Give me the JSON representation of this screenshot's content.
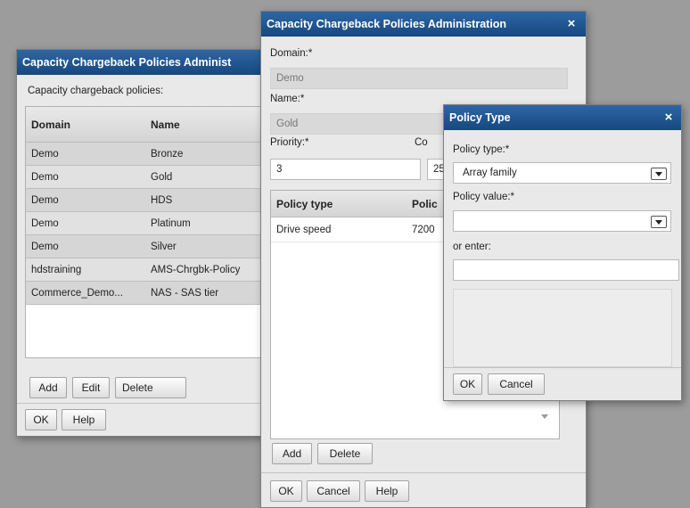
{
  "back": {
    "title": "Capacity Chargeback Policies Administ",
    "list_label": "Capacity chargeback policies:",
    "columns": [
      "Domain",
      "Name"
    ],
    "rows": [
      {
        "domain": "Demo",
        "name": "Bronze"
      },
      {
        "domain": "Demo",
        "name": "Gold"
      },
      {
        "domain": "Demo",
        "name": "HDS"
      },
      {
        "domain": "Demo",
        "name": "Platinum"
      },
      {
        "domain": "Demo",
        "name": "Silver"
      },
      {
        "domain": "hdstraining",
        "name": "AMS-Chrgbk-Policy"
      },
      {
        "domain": "Commerce_Demo...",
        "name": "NAS - SAS tier"
      }
    ],
    "add_label": "Add",
    "edit_label": "Edit",
    "delete_label": "Delete",
    "ok_label": "OK",
    "help_label": "Help"
  },
  "mid": {
    "title": "Capacity Chargeback Policies Administration",
    "close": "×",
    "domain_label": "Domain:*",
    "domain_value": "Demo",
    "name_label": "Name:*",
    "name_value": "Gold",
    "priority_label": "Priority:*",
    "priority_value": "3",
    "co_label": "Co",
    "co_value": "25",
    "columns": [
      "Policy type",
      "Polic"
    ],
    "rows": [
      {
        "type": "Drive speed",
        "value": "7200"
      }
    ],
    "add_label": "Add",
    "delete_label": "Delete",
    "ok_label": "OK",
    "cancel_label": "Cancel",
    "help_label": "Help"
  },
  "front": {
    "title": "Policy Type",
    "close": "×",
    "policy_type_label": "Policy type:*",
    "policy_type_value": "Array family",
    "policy_value_label": "Policy value:*",
    "policy_value_value": "",
    "or_enter_label": "or enter:",
    "or_enter_value": "",
    "ok_label": "OK",
    "cancel_label": "Cancel"
  },
  "colors": {
    "titlebar": "#1f5590",
    "backdrop": "#9c9c9c",
    "dialog": "#e9e9e9"
  }
}
